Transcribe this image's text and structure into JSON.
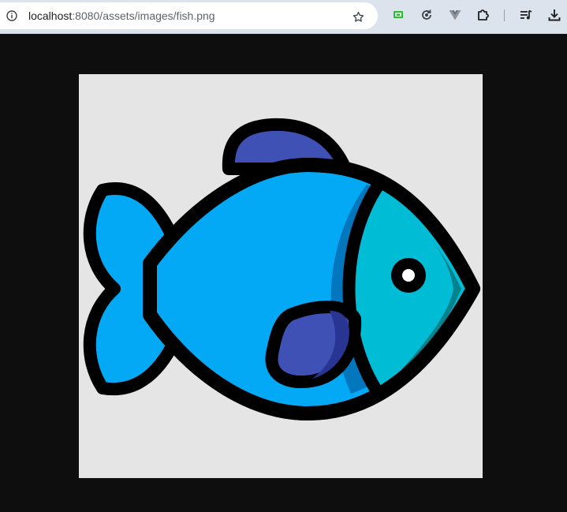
{
  "browser": {
    "address_bar": {
      "host": "localhost",
      "url_rest": ":8080/assets/images/fish.png",
      "icon": "info-icon"
    },
    "toolbar_icons": [
      "bookmark-star-icon",
      "screen-share-extension-icon",
      "sync-extension-icon",
      "vue-devtools-icon",
      "extensions-puzzle-icon",
      "reading-list-icon",
      "downloads-icon"
    ]
  },
  "page": {
    "background": "#0e0e0e",
    "image": {
      "subject": "fish-illustration",
      "background": "#e5e5e5",
      "colors": {
        "body": "#03a9f4",
        "face": "#00bcd4",
        "face_shade": "#00838f",
        "body_shade": "#0277bd",
        "fin": "#3f51b5",
        "fin_shade": "#283593",
        "outline": "#000000",
        "eye": "#ffffff"
      }
    }
  }
}
